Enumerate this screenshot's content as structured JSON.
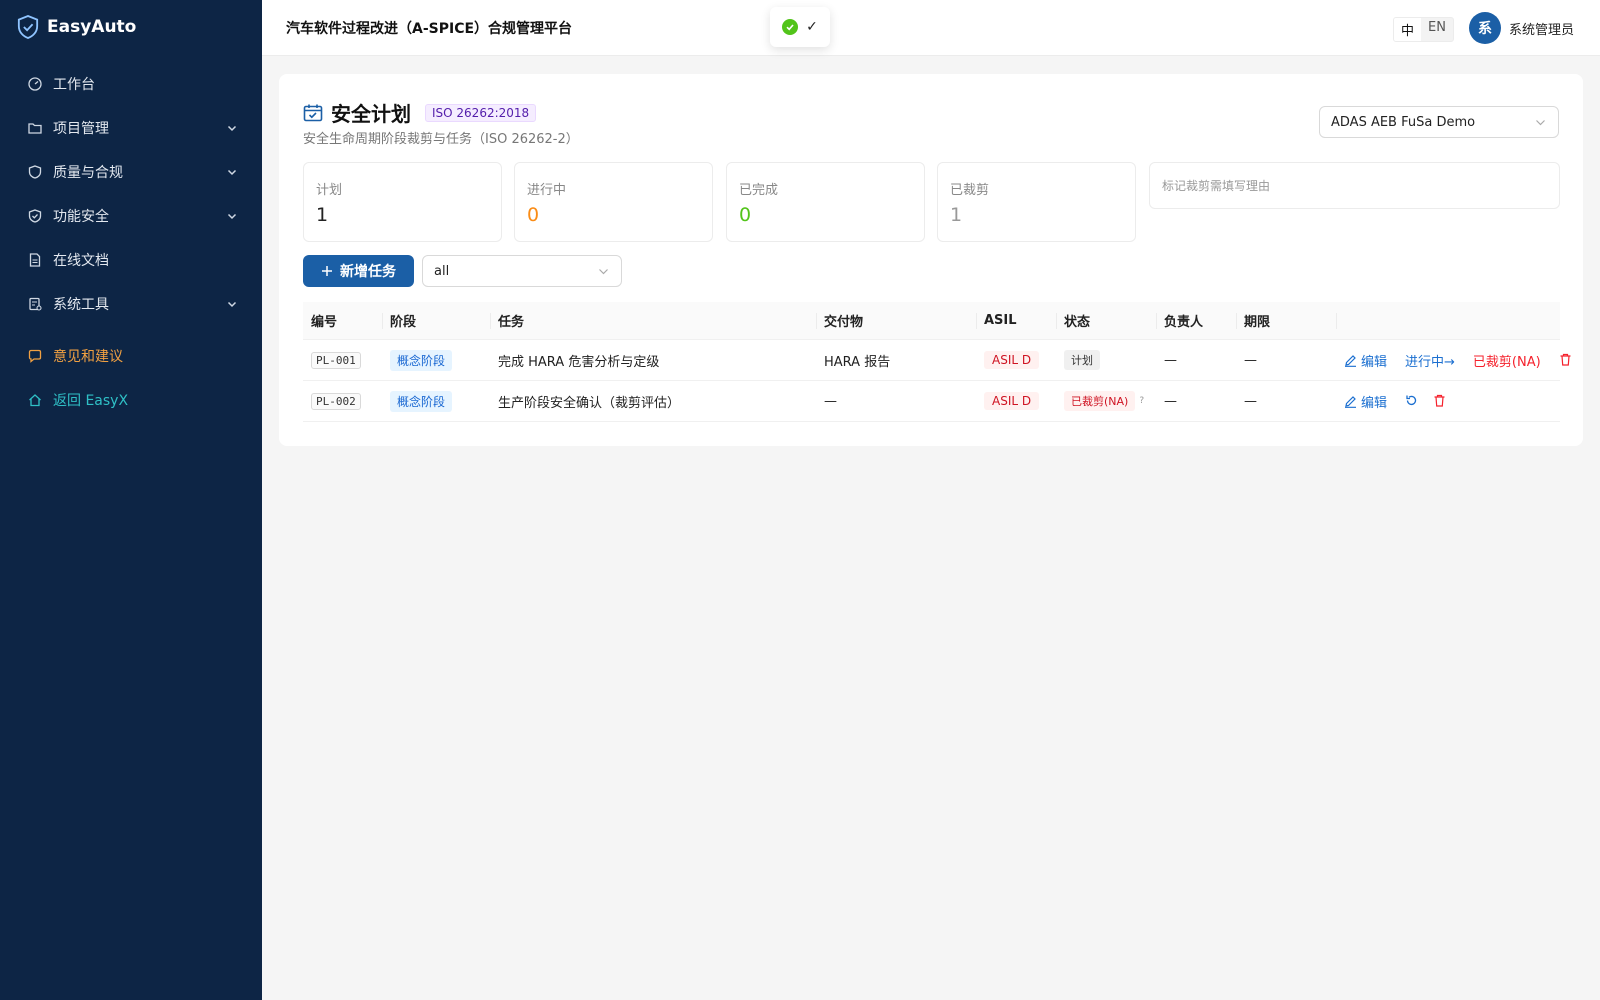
{
  "brand": {
    "name": "EasyAuto",
    "logo_icon": "shield-check-icon"
  },
  "sidebar": {
    "items": [
      {
        "label": "工作台",
        "icon": "dashboard-icon",
        "expandable": false
      },
      {
        "label": "项目管理",
        "icon": "folder-icon",
        "expandable": true
      },
      {
        "label": "质量与合规",
        "icon": "shield-icon",
        "expandable": true
      },
      {
        "label": "功能安全",
        "icon": "shield-check-icon",
        "expandable": true
      },
      {
        "label": "在线文档",
        "icon": "document-icon",
        "expandable": false
      },
      {
        "label": "系统工具",
        "icon": "tool-icon",
        "expandable": true
      }
    ],
    "feedback": {
      "label": "意见和建议",
      "icon": "chat-icon",
      "color": "#f0a042"
    },
    "back": {
      "label": "返回 EasyX",
      "icon": "home-icon",
      "color": "#2fc0c6"
    }
  },
  "header": {
    "title": "汽车软件过程改进（A-SPICE）合规管理平台",
    "lang": {
      "zh": "中",
      "en": "EN",
      "active": "zh"
    },
    "user": {
      "avatar_text": "系",
      "name": "系统管理员"
    }
  },
  "toast": {
    "message": "✓",
    "icon": "check-circle-icon"
  },
  "page": {
    "title": "安全计划",
    "standard_tag": "ISO 26262:2018",
    "subtitle": "安全生命周期阶段裁剪与任务（ISO 26262-2）",
    "project_select": {
      "value": "ADAS AEB FuSa Demo"
    }
  },
  "stats": [
    {
      "label": "计划",
      "value": "1"
    },
    {
      "label": "进行中",
      "value": "0"
    },
    {
      "label": "已完成",
      "value": "0"
    },
    {
      "label": "已裁剪",
      "value": "1"
    }
  ],
  "tailor_reason": {
    "placeholder": "标记裁剪需填写理由"
  },
  "toolbar": {
    "add_label": "新增任务",
    "filter_value": "all"
  },
  "table": {
    "columns": [
      "编号",
      "阶段",
      "任务",
      "交付物",
      "ASIL",
      "状态",
      "负责人",
      "期限",
      ""
    ],
    "rows": [
      {
        "id": "PL-001",
        "phase": "概念阶段",
        "task": "完成 HARA 危害分析与定级",
        "deliverable": "HARA 报告",
        "asil": "ASIL D",
        "status": "计划",
        "owner": "—",
        "deadline": "—",
        "actions": {
          "edit": "编辑",
          "progress": "进行中→",
          "tailor": "已裁剪(NA)"
        }
      },
      {
        "id": "PL-002",
        "phase": "概念阶段",
        "task": "生产阶段安全确认（裁剪评估）",
        "deliverable": "—",
        "asil": "ASIL D",
        "status": "已裁剪(NA)",
        "status_hint": "?",
        "owner": "—",
        "deadline": "—",
        "actions": {
          "edit": "编辑"
        }
      }
    ]
  },
  "colors": {
    "sidebar_bg": "#0d2545",
    "primary": "#1b5fa6",
    "danger": "#f5222d",
    "success": "#52c41a",
    "warning": "#fa8c16"
  }
}
